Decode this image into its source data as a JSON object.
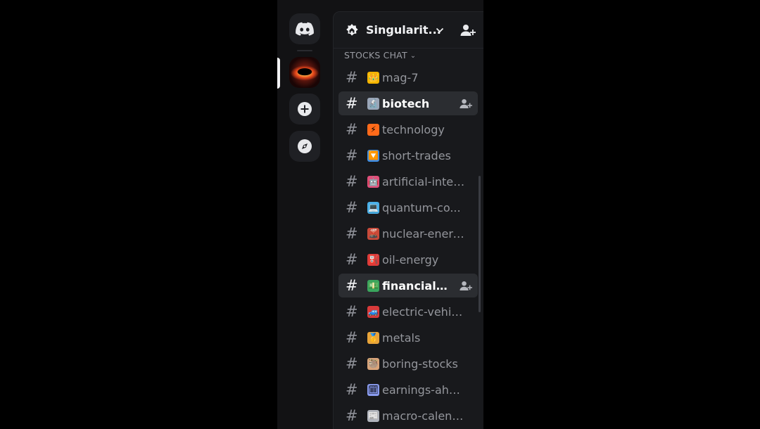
{
  "server": {
    "name": "Singularit...",
    "category": "STOCKS CHAT"
  },
  "rail": {
    "items": [
      "discord-home",
      "singularity-server",
      "add-server",
      "discover"
    ]
  },
  "channels": [
    {
      "name": "mag-7",
      "emoji": "👑",
      "emoji_bg": "#f4b400",
      "active": false
    },
    {
      "name": "biotech",
      "emoji": "🔬",
      "emoji_bg": "#9aa6b8",
      "active": true
    },
    {
      "name": "technology",
      "emoji": "⚡",
      "emoji_bg": "#ff6a1a",
      "active": false
    },
    {
      "name": "short-trades",
      "emoji": "🔽",
      "emoji_bg": "#3b8fe8",
      "active": false
    },
    {
      "name": "artificial-intel...",
      "emoji": "🤖",
      "emoji_bg": "#e04f7a",
      "active": false
    },
    {
      "name": "quantum-co...",
      "emoji": "💻",
      "emoji_bg": "#4ab0e8",
      "active": false
    },
    {
      "name": "nuclear-energy",
      "emoji": "🌋",
      "emoji_bg": "#c84a3a",
      "active": false
    },
    {
      "name": "oil-energy",
      "emoji": "⛽",
      "emoji_bg": "#d93a3a",
      "active": false
    },
    {
      "name": "financial-s...",
      "emoji": "💵",
      "emoji_bg": "#3aa55d",
      "active": true
    },
    {
      "name": "electric-vehic...",
      "emoji": "🚙",
      "emoji_bg": "#d93a3a",
      "active": false
    },
    {
      "name": "metals",
      "emoji": "🥇",
      "emoji_bg": "#e8a43a",
      "active": false
    },
    {
      "name": "boring-stocks",
      "emoji": "🦥",
      "emoji_bg": "#d9a47a",
      "active": false
    },
    {
      "name": "earnings-ahead",
      "emoji": "🗓",
      "emoji_bg": "#8a9cf0",
      "active": false
    },
    {
      "name": "macro-calend...",
      "emoji": "📰",
      "emoji_bg": "#b0b4bc",
      "active": false
    }
  ],
  "colors": {
    "background": "#000000",
    "rail": "#121214",
    "panel": "#18191c",
    "active_row": "#2b2d31",
    "text_muted": "#94969c",
    "text_bright": "#f2f3f5"
  }
}
